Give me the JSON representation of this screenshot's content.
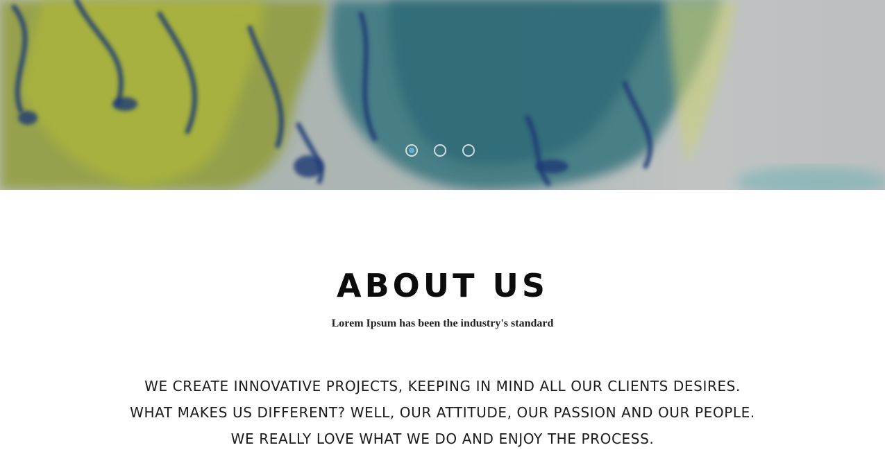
{
  "hero": {
    "slider_dots": [
      {
        "label": "slide 1",
        "active": true
      },
      {
        "label": "slide 2",
        "active": false
      },
      {
        "label": "slide 3",
        "active": false
      }
    ],
    "accent_color": "#5fb3d6"
  },
  "about": {
    "title": "ABOUT US",
    "subtitle": "Lorem Ipsum has been the industry's standard",
    "lead": "WE CREATE INNOVATIVE PROJECTS, KEEPING IN MIND ALL OUR CLIENTS DESIRES. WHAT MAKES US DIFFERENT? WELL, OUR ATTITUDE, OUR PASSION AND OUR PEOPLE. WE REALLY LOVE WHAT WE DO AND ENJOY THE PROCESS."
  }
}
